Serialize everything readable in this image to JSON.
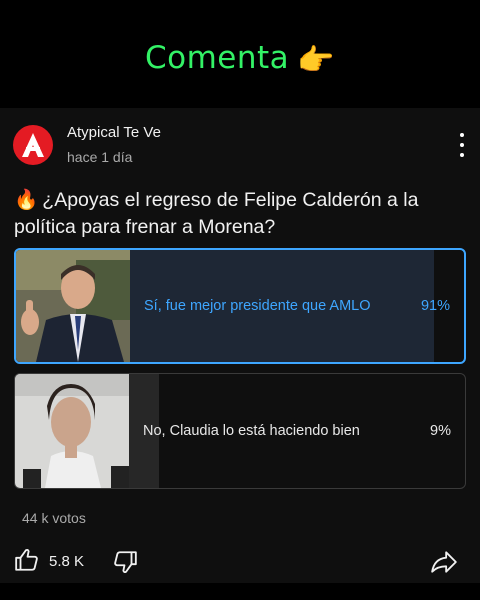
{
  "banner": {
    "text": "Comenta",
    "icon": "pointing-right-hand-icon",
    "color": "#33f266"
  },
  "post": {
    "channel": "Atypical Te Ve",
    "avatar_letter": "A",
    "avatar_color": "#e41b23",
    "time": "hace 1 día",
    "question": "¿Apoyas el regreso de Felipe Calderón a la política para frenar a Morena?",
    "question_icon": "fire-icon"
  },
  "poll": {
    "options": [
      {
        "label": "Sí, fue mejor presidente que AMLO",
        "percent_text": "91%",
        "percent": 91,
        "selected": true
      },
      {
        "label": "No, Claudia lo está haciendo bien",
        "percent_text": "9%",
        "percent": 9,
        "selected": false
      }
    ],
    "votes": "44 k votos",
    "accent_color": "#3ea6ff"
  },
  "actions": {
    "likes": "5.8 K"
  }
}
